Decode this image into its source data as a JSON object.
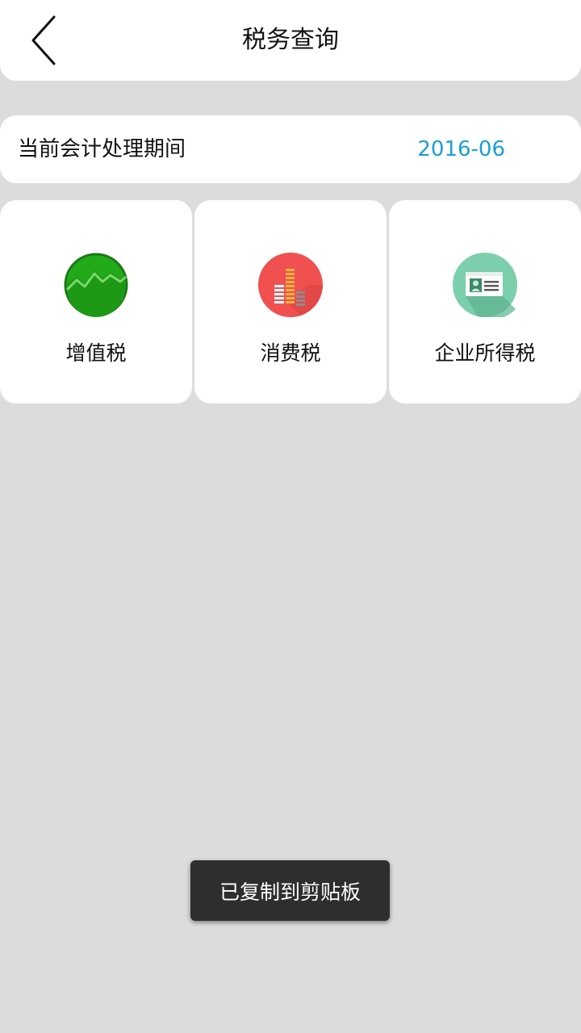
{
  "header": {
    "title": "税务查询",
    "back_icon": "chevron-left-icon"
  },
  "period": {
    "label": "当前会计处理期间",
    "value": "2016-06",
    "value_color": "#1a9fd6"
  },
  "tiles": [
    {
      "label": "增值税",
      "icon": "green-chart-icon",
      "color": "#22aa1a"
    },
    {
      "label": "消费税",
      "icon": "red-bar-chart-icon",
      "color": "#f05050"
    },
    {
      "label": "企业所得税",
      "icon": "id-card-icon",
      "color": "#7ccfad"
    }
  ],
  "toast": {
    "text": "已复制到剪贴板"
  }
}
